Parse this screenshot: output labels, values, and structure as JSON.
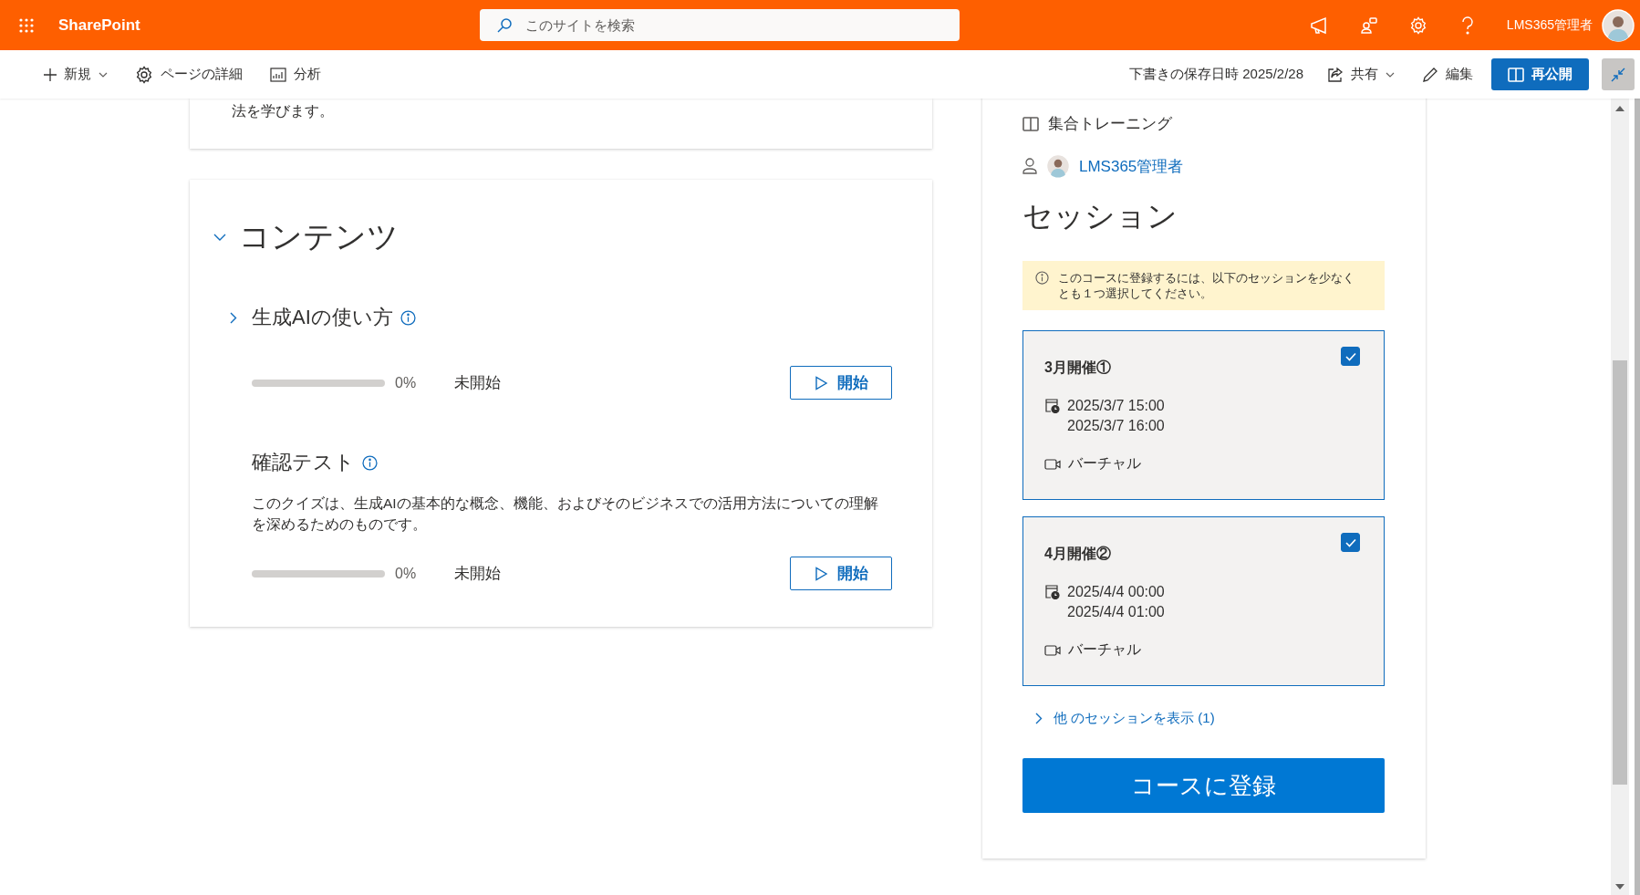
{
  "suite_bar": {
    "app_name": "SharePoint",
    "search": {
      "placeholder": "このサイトを検索"
    },
    "user_name": "LMS365管理者"
  },
  "command_bar": {
    "left": [
      {
        "label": "新規",
        "has_menu": true
      },
      {
        "label": "ページの詳細",
        "has_menu": false
      },
      {
        "label": "分析",
        "has_menu": false
      }
    ],
    "draft_saved": "下書きの保存日時 2025/2/28",
    "share": "共有",
    "edit": "編集",
    "republish": "再公開"
  },
  "intro_card": {
    "text": "法を学びます。"
  },
  "contents": {
    "title": "コンテンツ",
    "expanded": true,
    "items": [
      {
        "kind": "module",
        "title": "生成AIの使い方",
        "level": 0,
        "percent": "0%",
        "status": "未開始",
        "action": "開始"
      },
      {
        "kind": "quiz",
        "title": "確認テスト",
        "description": "このクイズは、生成AIの基本的な概念、機能、およびそのビジネスでの活用方法についての理解を深めるためのものです。",
        "level": 0,
        "percent": "0%",
        "status": "未開始",
        "action": "開始"
      }
    ]
  },
  "course_info": {
    "type": "集合トレーニング",
    "author": "LMS365管理者"
  },
  "sessions": {
    "title": "セッション",
    "notice": "このコースに登録するには、以下のセッションを少なくとも１つ選択してください。",
    "items": [
      {
        "name": "3月開催①",
        "start": "2025/3/7 15:00",
        "end": "2025/3/7 16:00",
        "location": "バーチャル",
        "checked": true
      },
      {
        "name": "4月開催②",
        "start": "2025/4/4 00:00",
        "end": "2025/4/4 01:00",
        "location": "バーチャル",
        "checked": true
      }
    ],
    "more_link": "他 のセッションを表示 (1)",
    "register_button": "コースに登録"
  }
}
